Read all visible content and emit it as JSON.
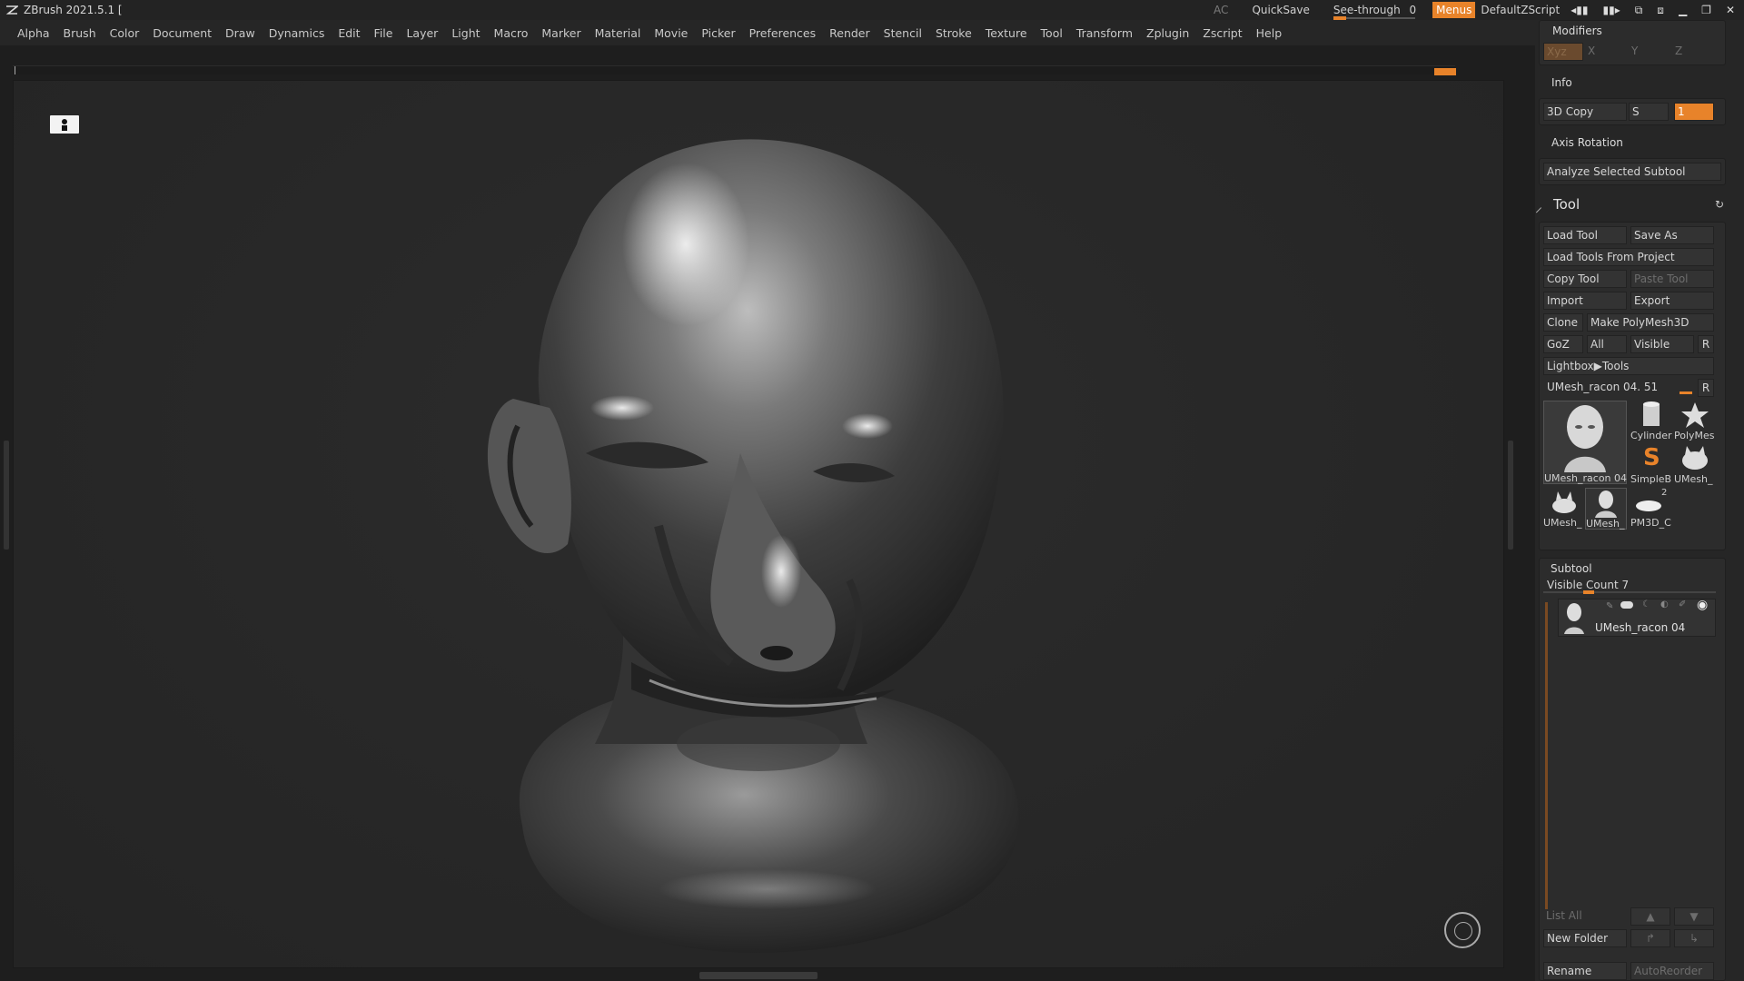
{
  "titlebar": {
    "title": "ZBrush 2021.5.1 [",
    "ac": "AC",
    "quicksave": "QuickSave",
    "see_through_label": "See-through",
    "see_through_value": "0",
    "menus": "Menus",
    "script": "DefaultZScript"
  },
  "menubar": {
    "items": [
      "Alpha",
      "Brush",
      "Color",
      "Document",
      "Draw",
      "Dynamics",
      "Edit",
      "File",
      "Layer",
      "Light",
      "Macro",
      "Marker",
      "Material",
      "Movie",
      "Picker",
      "Preferences",
      "Render",
      "Stencil",
      "Stroke",
      "Texture",
      "Tool",
      "Transform",
      "Zplugin",
      "Zscript",
      "Help"
    ]
  },
  "rpanel": {
    "modifiers": {
      "title": "Modifiers",
      "axes": [
        "Xyz",
        "X",
        "Y",
        "Z"
      ]
    },
    "info": "Info",
    "copy3d": {
      "label": "3D Copy",
      "s": "S",
      "value": "1"
    },
    "axis_rotation": "Axis Rotation",
    "analyze": "Analyze Selected Subtool",
    "tool": {
      "title": "Tool",
      "load_tool": "Load Tool",
      "save_as": "Save As",
      "load_from_project": "Load Tools From Project",
      "copy_tool": "Copy Tool",
      "paste_tool": "Paste Tool",
      "import": "Import",
      "export": "Export",
      "clone": "Clone",
      "make_polymesh": "Make PolyMesh3D",
      "goz": "GoZ",
      "all": "All",
      "visible": "Visible",
      "r": "R",
      "lightbox_tools": "Lightbox▶Tools",
      "current_tool": "UMesh_racon 04. 51",
      "thumbs": {
        "main": "UMesh_racon 04",
        "cylinder": "Cylinder",
        "polymesh": "PolyMes",
        "simpleb": "SimpleB",
        "umesh2": "UMesh_",
        "umesh3": "UMesh_",
        "umesh4": "UMesh_",
        "pm3d": "PM3D_C",
        "pm3d_count": "2"
      }
    },
    "subtool": {
      "title": "Subtool",
      "visible_count": "Visible Count 7",
      "item_name": "UMesh_racon 04",
      "list_all": "List All",
      "new_folder": "New Folder",
      "rename": "Rename",
      "autoreorder": "AutoReorder"
    }
  },
  "colors": {
    "accent": "#e8832a",
    "panel": "#262626",
    "canvas": "#282828"
  }
}
